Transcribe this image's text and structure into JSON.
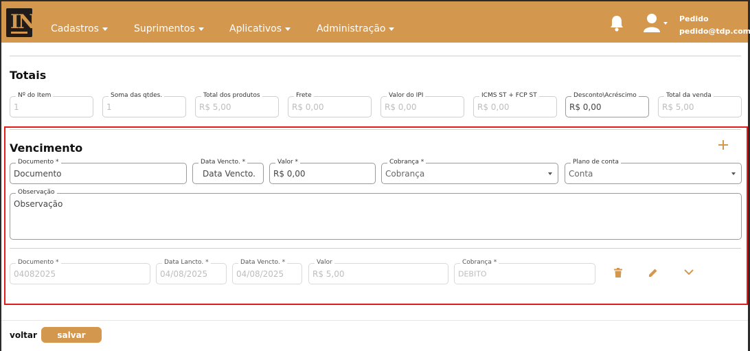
{
  "header": {
    "logo_text": "IN",
    "nav": [
      "Cadastros",
      "Suprimentos",
      "Aplicativos",
      "Administração"
    ],
    "user_name": "Pedido",
    "user_email": "pedido@tdp.com.br"
  },
  "totais": {
    "title": "Totais",
    "fields": [
      {
        "label": "Nº do Item",
        "value": "1"
      },
      {
        "label": "Soma das qtdes.",
        "value": "1"
      },
      {
        "label": "Total dos produtos",
        "value": "R$ 5,00"
      },
      {
        "label": "Frete",
        "value": "R$ 0,00"
      },
      {
        "label": "Valor do IPI",
        "value": "R$ 0,00"
      },
      {
        "label": "ICMS ST + FCP ST",
        "value": "R$ 0,00"
      },
      {
        "label": "Desconto\\Acréscimo",
        "value": "R$ 0,00"
      },
      {
        "label": "Total da venda",
        "value": "R$ 5,00"
      }
    ]
  },
  "vencimento": {
    "title": "Vencimento",
    "form": {
      "documento": {
        "label": "Documento *",
        "value": "Documento"
      },
      "data_vencto": {
        "label": "Data Vencto. *",
        "value": "Data Vencto."
      },
      "valor": {
        "label": "Valor *",
        "value": "R$ 0,00"
      },
      "cobranca": {
        "label": "Cobrança *",
        "value": "Cobrança"
      },
      "plano_conta": {
        "label": "Plano de conta",
        "value": "Conta"
      },
      "observacao": {
        "label": "Observação",
        "value": "Observação"
      }
    },
    "row": {
      "documento": {
        "label": "Documento *",
        "value": "04082025"
      },
      "data_lancto": {
        "label": "Data Lancto. *",
        "value": "04/08/2025"
      },
      "data_vencto": {
        "label": "Data Vencto. *",
        "value": "04/08/2025"
      },
      "valor": {
        "label": "Valor",
        "value": "R$ 5,00"
      },
      "cobranca": {
        "label": "Cobrança *",
        "value": "DEBITO"
      }
    }
  },
  "footer": {
    "voltar": "voltar",
    "salvar": "salvar"
  },
  "colors": {
    "brand": "#d4974e",
    "highlight": "#e01b1b"
  }
}
